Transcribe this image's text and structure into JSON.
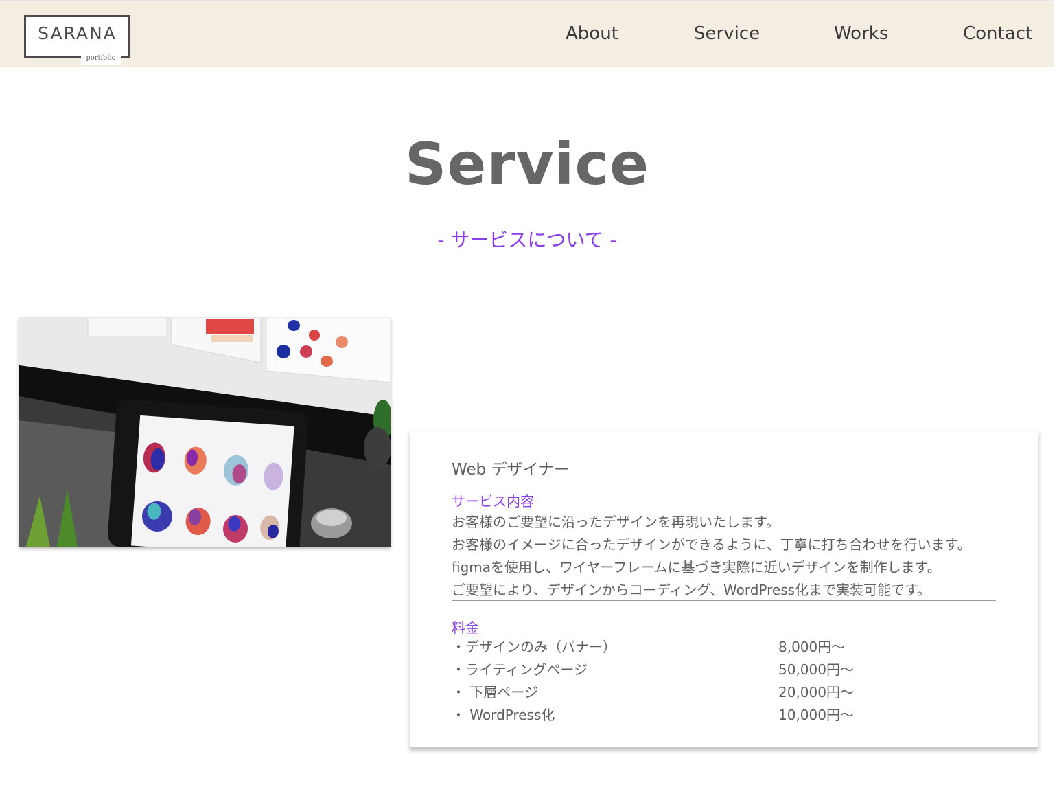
{
  "header": {
    "logo_text": "SARANA",
    "logo_sub": "portfolio",
    "nav": [
      {
        "label": "About"
      },
      {
        "label": "Service"
      },
      {
        "label": "Works"
      },
      {
        "label": "Contact"
      }
    ]
  },
  "main": {
    "title": "Service",
    "subtitle": "- サービスについて -",
    "card": {
      "title": "Web デザイナー",
      "service_label": "サービス内容",
      "description": [
        "お客様のご要望に沿ったデザインを再現いたします。",
        "お客様のイメージに合ったデザインができるように、丁寧に打ち合わせを行います。",
        "figmaを使用し、ワイヤーフレームに基づき実際に近いデザインを制作します。",
        "ご要望により、デザインからコーディング、WordPress化まで実装可能です。"
      ],
      "price_label": "料金",
      "prices": [
        {
          "item": "・デザインのみ（バナー）",
          "price": "8,000円〜"
        },
        {
          "item": "・ライティングページ",
          "price": "50,000円〜"
        },
        {
          "item": "・ 下層ページ",
          "price": "20,000円〜"
        },
        {
          "item": "・ WordPress化",
          "price": "10,000円〜"
        }
      ]
    }
  },
  "colors": {
    "header_bg": "#f3ede2",
    "accent": "#8a3ee8",
    "text": "#5f5f5f"
  },
  "icons": [
    "design-workspace-photo"
  ]
}
